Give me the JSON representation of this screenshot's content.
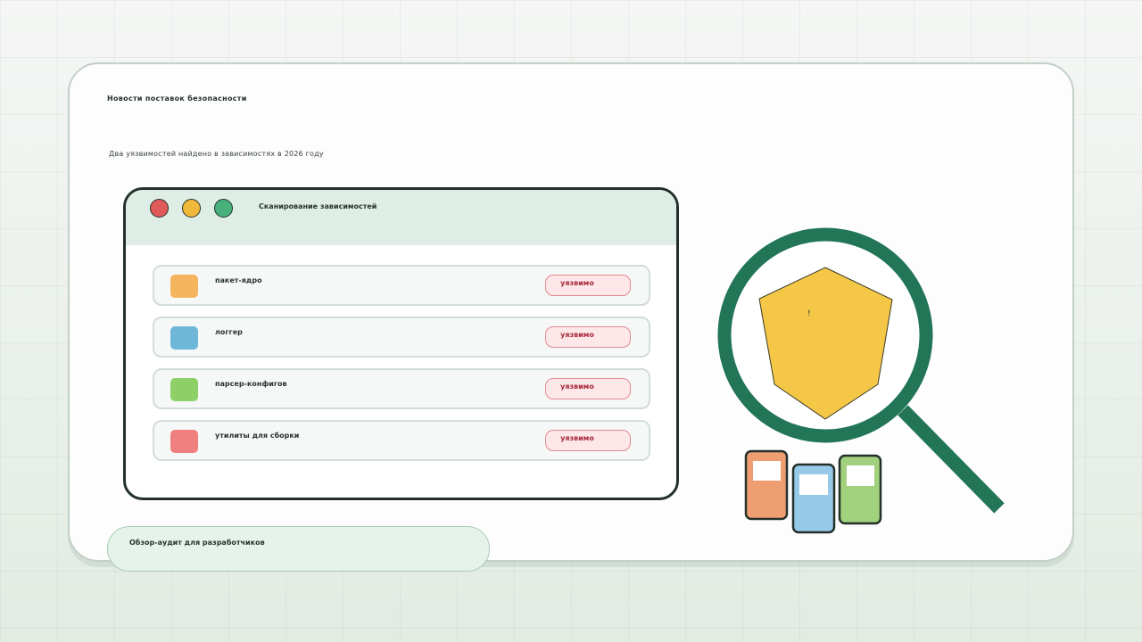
{
  "headline": "Новости поставок безопасности",
  "subhead": "Два уязвимостей найдено в зависимостях в 2026 году",
  "window": {
    "title": "Сканирование зависимостей",
    "rows": [
      {
        "label": "пакет-ядро",
        "badge": "уязвимо",
        "color": "#f4b55e"
      },
      {
        "label": "логгер",
        "badge": "уязвимо",
        "color": "#6fb7d8"
      },
      {
        "label": "парсер-конфигов",
        "badge": "уязвимо",
        "color": "#8ed068"
      },
      {
        "label": "утилиты для сборки",
        "badge": "уязвимо",
        "color": "#f08080"
      }
    ]
  },
  "footer": {
    "text": "Обзор-аудит для разработчиков"
  },
  "illustration": {
    "shield_mark": "!",
    "lens_color": "#227557",
    "shield_color": "#f4c746",
    "block_colors": [
      "#ef9e72",
      "#97c9e8",
      "#a2d17d"
    ]
  }
}
